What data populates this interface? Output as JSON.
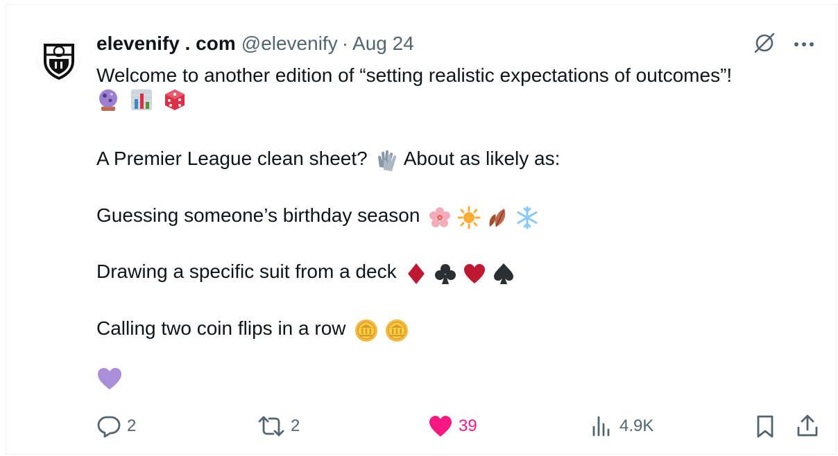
{
  "tweet": {
    "author_name": "elevenify . com",
    "handle": "@elevenify",
    "separator": "·",
    "date": "Aug 24",
    "lines": [
      "Welcome to another edition of “setting realistic expectations of outcomes”!",
      "A Premier League clean sheet?",
      "About as likely as:",
      "Guessing someone’s birthday season",
      "Drawing a specific suit from a deck",
      "Calling two coin flips in a row"
    ],
    "emoji_row_1": [
      "crystal-ball-icon",
      "bar-chart-icon",
      "die-icon"
    ],
    "glove_emoji": "gloves-icon",
    "season_emojis": [
      "cherry-blossom-icon",
      "sun-icon",
      "fallen-leaf-icon",
      "snowflake-icon"
    ],
    "suit_emojis": [
      "diamond-suit-icon",
      "club-suit-icon",
      "heart-suit-icon",
      "spade-suit-icon"
    ],
    "coin_emojis": [
      "coin-icon",
      "coin-icon"
    ],
    "reaction": "purple-heart-icon"
  },
  "actions": {
    "replies": "2",
    "reposts": "2",
    "likes": "39",
    "views": "4.9K"
  },
  "colors": {
    "text": "#0f1419",
    "muted": "#536471",
    "like": "#f91880",
    "purple_heart": "#ab8ed8"
  }
}
